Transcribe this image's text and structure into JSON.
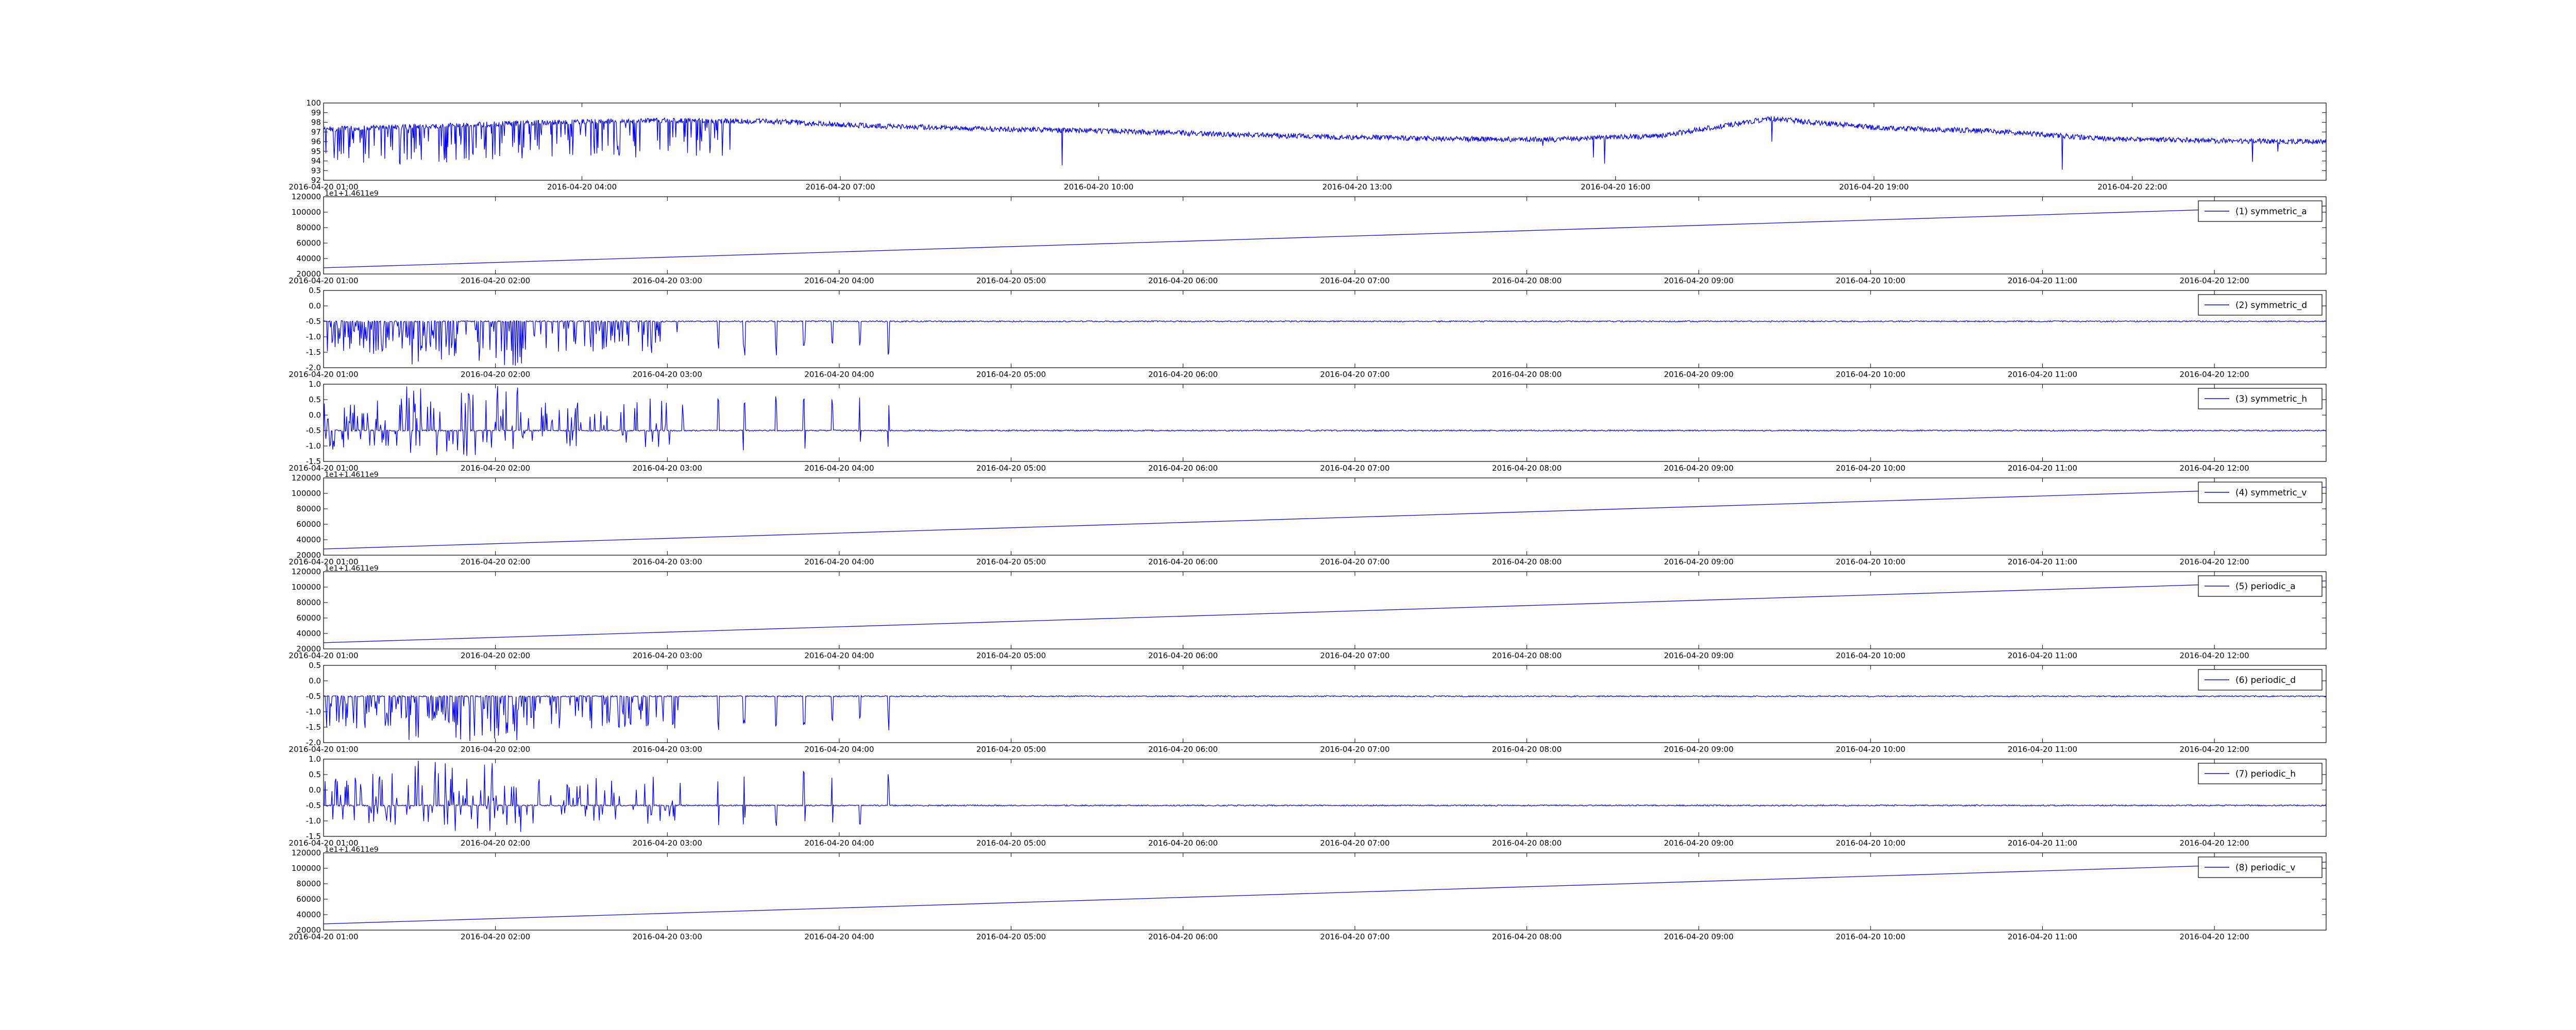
{
  "chart_data": [
    {
      "type": "line",
      "x_ticks": [
        "2016-04-20 01:00",
        "2016-04-20 04:00",
        "2016-04-20 07:00",
        "2016-04-20 10:00",
        "2016-04-20 13:00",
        "2016-04-20 16:00",
        "2016-04-20 19:00",
        "2016-04-20 22:00"
      ],
      "yticks": [
        92,
        93,
        94,
        95,
        96,
        97,
        98,
        99,
        100
      ],
      "ylim": [
        92,
        100
      ],
      "series": [
        {
          "color": "#0000ff",
          "baseline": [
            97.3,
            97.6,
            98.0,
            98.2,
            98.1,
            97.6,
            97.3,
            97.1,
            96.8,
            96.5,
            96.3,
            96.2,
            96.6,
            98.4,
            97.4,
            97.1,
            96.3,
            96.1,
            96.0
          ],
          "spikes": "dense-early"
        }
      ]
    },
    {
      "type": "line",
      "x_ticks": [
        "2016-04-20 01:00",
        "2016-04-20 02:00",
        "2016-04-20 03:00",
        "2016-04-20 04:00",
        "2016-04-20 05:00",
        "2016-04-20 06:00",
        "2016-04-20 07:00",
        "2016-04-20 08:00",
        "2016-04-20 09:00",
        "2016-04-20 10:00",
        "2016-04-20 11:00",
        "2016-04-20 12:00"
      ],
      "yticks": [
        20000,
        40000,
        60000,
        80000,
        100000,
        120000
      ],
      "ylim": [
        20000,
        120000
      ],
      "offset_text": "1e1+1.4611e9",
      "series": [
        {
          "name": "(1) symmetric_a",
          "color": "#0000ff",
          "start": 28000,
          "end": 108000
        }
      ]
    },
    {
      "type": "line",
      "x_ticks": [
        "2016-04-20 01:00",
        "2016-04-20 02:00",
        "2016-04-20 03:00",
        "2016-04-20 04:00",
        "2016-04-20 05:00",
        "2016-04-20 06:00",
        "2016-04-20 07:00",
        "2016-04-20 08:00",
        "2016-04-20 09:00",
        "2016-04-20 10:00",
        "2016-04-20 11:00",
        "2016-04-20 12:00"
      ],
      "yticks": [
        -2.0,
        -1.5,
        -1.0,
        -0.5,
        0.0,
        0.5
      ],
      "ylim": [
        -2.0,
        0.5
      ],
      "series": [
        {
          "name": "(2) symmetric_d",
          "color": "#0000ff",
          "baseline": -0.5,
          "spike_dir": "down"
        }
      ]
    },
    {
      "type": "line",
      "x_ticks": [
        "2016-04-20 01:00",
        "2016-04-20 02:00",
        "2016-04-20 03:00",
        "2016-04-20 04:00",
        "2016-04-20 05:00",
        "2016-04-20 06:00",
        "2016-04-20 07:00",
        "2016-04-20 08:00",
        "2016-04-20 09:00",
        "2016-04-20 10:00",
        "2016-04-20 11:00",
        "2016-04-20 12:00"
      ],
      "yticks": [
        -1.5,
        -1.0,
        -0.5,
        0.0,
        0.5,
        1.0
      ],
      "ylim": [
        -1.5,
        1.0
      ],
      "series": [
        {
          "name": "(3) symmetric_h",
          "color": "#0000ff",
          "baseline": -0.5,
          "spike_dir": "up"
        }
      ]
    },
    {
      "type": "line",
      "x_ticks": [
        "2016-04-20 01:00",
        "2016-04-20 02:00",
        "2016-04-20 03:00",
        "2016-04-20 04:00",
        "2016-04-20 05:00",
        "2016-04-20 06:00",
        "2016-04-20 07:00",
        "2016-04-20 08:00",
        "2016-04-20 09:00",
        "2016-04-20 10:00",
        "2016-04-20 11:00",
        "2016-04-20 12:00"
      ],
      "yticks": [
        20000,
        40000,
        60000,
        80000,
        100000,
        120000
      ],
      "ylim": [
        20000,
        120000
      ],
      "offset_text": "1e1+1.4611e9",
      "series": [
        {
          "name": "(4) symmetric_v",
          "color": "#0000ff",
          "start": 28000,
          "end": 108000
        }
      ]
    },
    {
      "type": "line",
      "x_ticks": [
        "2016-04-20 01:00",
        "2016-04-20 02:00",
        "2016-04-20 03:00",
        "2016-04-20 04:00",
        "2016-04-20 05:00",
        "2016-04-20 06:00",
        "2016-04-20 07:00",
        "2016-04-20 08:00",
        "2016-04-20 09:00",
        "2016-04-20 10:00",
        "2016-04-20 11:00",
        "2016-04-20 12:00"
      ],
      "yticks": [
        20000,
        40000,
        60000,
        80000,
        100000,
        120000
      ],
      "ylim": [
        20000,
        120000
      ],
      "offset_text": "1e1+1.4611e9",
      "series": [
        {
          "name": "(5) periodic_a",
          "color": "#0000ff",
          "start": 28000,
          "end": 108000
        }
      ]
    },
    {
      "type": "line",
      "x_ticks": [
        "2016-04-20 01:00",
        "2016-04-20 02:00",
        "2016-04-20 03:00",
        "2016-04-20 04:00",
        "2016-04-20 05:00",
        "2016-04-20 06:00",
        "2016-04-20 07:00",
        "2016-04-20 08:00",
        "2016-04-20 09:00",
        "2016-04-20 10:00",
        "2016-04-20 11:00",
        "2016-04-20 12:00"
      ],
      "yticks": [
        -2.0,
        -1.5,
        -1.0,
        -0.5,
        0.0,
        0.5
      ],
      "ylim": [
        -2.0,
        0.5
      ],
      "series": [
        {
          "name": "(6) periodic_d",
          "color": "#0000ff",
          "baseline": -0.5,
          "spike_dir": "down"
        }
      ]
    },
    {
      "type": "line",
      "x_ticks": [
        "2016-04-20 01:00",
        "2016-04-20 02:00",
        "2016-04-20 03:00",
        "2016-04-20 04:00",
        "2016-04-20 05:00",
        "2016-04-20 06:00",
        "2016-04-20 07:00",
        "2016-04-20 08:00",
        "2016-04-20 09:00",
        "2016-04-20 10:00",
        "2016-04-20 11:00",
        "2016-04-20 12:00"
      ],
      "yticks": [
        -1.5,
        -1.0,
        -0.5,
        0.0,
        0.5,
        1.0
      ],
      "ylim": [
        -1.5,
        1.0
      ],
      "series": [
        {
          "name": "(7) periodic_h",
          "color": "#0000ff",
          "baseline": -0.5,
          "spike_dir": "up"
        }
      ]
    },
    {
      "type": "line",
      "x_ticks": [
        "2016-04-20 01:00",
        "2016-04-20 02:00",
        "2016-04-20 03:00",
        "2016-04-20 04:00",
        "2016-04-20 05:00",
        "2016-04-20 06:00",
        "2016-04-20 07:00",
        "2016-04-20 08:00",
        "2016-04-20 09:00",
        "2016-04-20 10:00",
        "2016-04-20 11:00",
        "2016-04-20 12:00"
      ],
      "yticks": [
        20000,
        40000,
        60000,
        80000,
        100000,
        120000
      ],
      "ylim": [
        20000,
        120000
      ],
      "offset_text": "1e1+1.4611e9",
      "series": [
        {
          "name": "(8) periodic_v",
          "color": "#0000ff",
          "start": 28000,
          "end": 108000
        }
      ]
    }
  ]
}
